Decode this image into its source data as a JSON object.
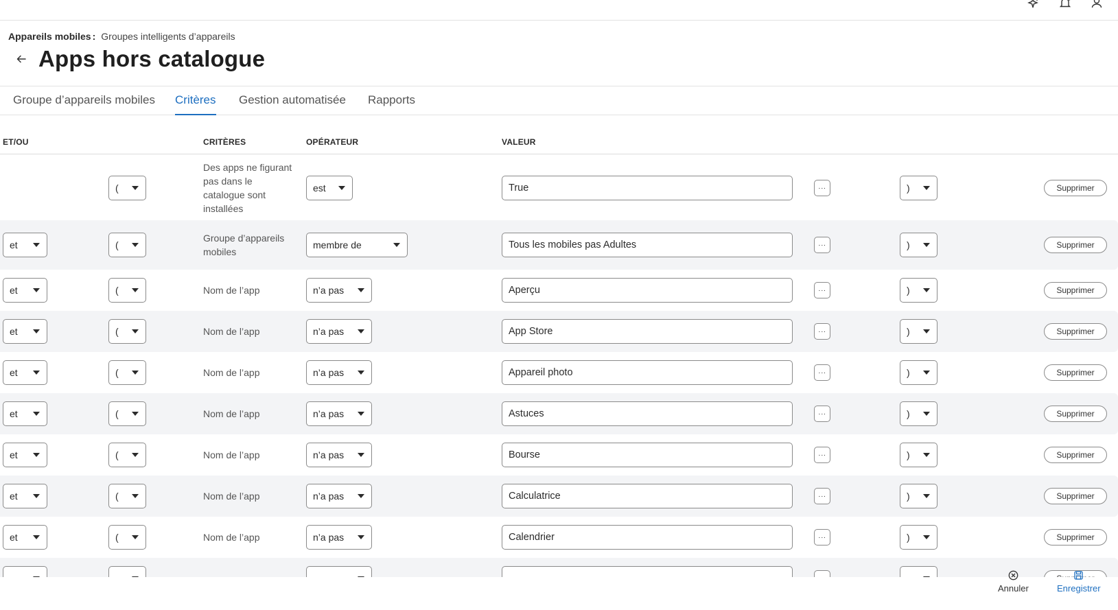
{
  "topbar": {
    "icons": [
      "sparkle-icon",
      "bell-icon",
      "user-icon"
    ]
  },
  "breadcrumb": {
    "root": "Appareils mobiles",
    "separator": ":",
    "current": "Groupes intelligents d’appareils"
  },
  "page": {
    "title": "Apps hors catalogue"
  },
  "tabs": [
    {
      "label": "Groupe d’appareils mobiles",
      "active": false
    },
    {
      "label": "Critères",
      "active": true
    },
    {
      "label": "Gestion automatisée",
      "active": false
    },
    {
      "label": "Rapports",
      "active": false
    }
  ],
  "table": {
    "headers": {
      "andor": "ET/OU",
      "criteria": "CRITÈRES",
      "operator": "OPÉRATEUR",
      "value": "VALEUR"
    },
    "more_label": "···",
    "delete_label": "Supprimer",
    "rows": [
      {
        "andor": "",
        "open": "(",
        "criteria": "Des apps ne figurant pas dans le catalogue sont installées",
        "operator": "est",
        "value": "True",
        "close": ")"
      },
      {
        "andor": "et",
        "open": "(",
        "criteria": "Groupe d’appareils mobiles",
        "operator": "membre de",
        "value": "Tous les mobiles pas Adultes",
        "close": ")"
      },
      {
        "andor": "et",
        "open": "(",
        "criteria": "Nom de l’app",
        "operator": "n’a pas",
        "value": "Aperçu",
        "close": ")"
      },
      {
        "andor": "et",
        "open": "(",
        "criteria": "Nom de l’app",
        "operator": "n’a pas",
        "value": "App Store",
        "close": ")"
      },
      {
        "andor": "et",
        "open": "(",
        "criteria": "Nom de l’app",
        "operator": "n’a pas",
        "value": "Appareil photo",
        "close": ")"
      },
      {
        "andor": "et",
        "open": "(",
        "criteria": "Nom de l’app",
        "operator": "n’a pas",
        "value": "Astuces",
        "close": ")"
      },
      {
        "andor": "et",
        "open": "(",
        "criteria": "Nom de l’app",
        "operator": "n’a pas",
        "value": "Bourse",
        "close": ")"
      },
      {
        "andor": "et",
        "open": "(",
        "criteria": "Nom de l’app",
        "operator": "n’a pas",
        "value": "Calculatrice",
        "close": ")"
      },
      {
        "andor": "et",
        "open": "(",
        "criteria": "Nom de l’app",
        "operator": "n’a pas",
        "value": "Calendrier",
        "close": ")"
      },
      {
        "andor": "",
        "open": "",
        "criteria": "",
        "operator": "",
        "value": "",
        "close": ""
      }
    ]
  },
  "footer": {
    "cancel_label": "Annuler",
    "save_label": "Enregistrer"
  },
  "colors": {
    "accent": "#1e6fc0",
    "row_alt": "#f3f4f6",
    "border": "#8a8a8a"
  }
}
